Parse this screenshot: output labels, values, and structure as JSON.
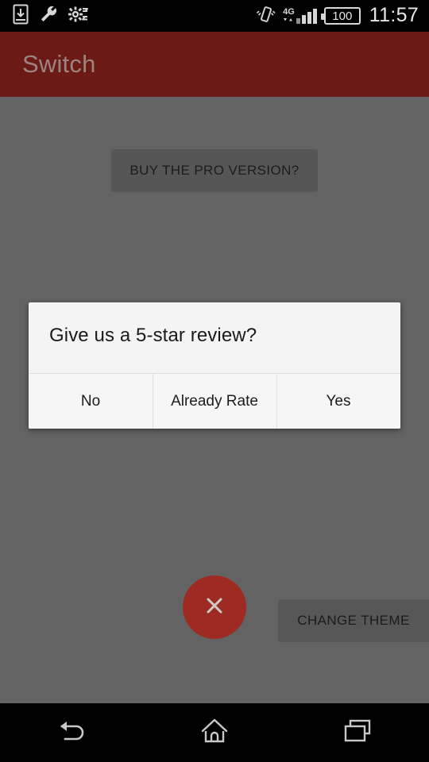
{
  "status_bar": {
    "icons_left": [
      {
        "name": "download-to-device-icon",
        "label": "download"
      },
      {
        "name": "wrench-icon",
        "label": "wrench"
      },
      {
        "name": "gear-sync-icon",
        "label": "settings-sync"
      }
    ],
    "icons_right": [
      {
        "name": "vibrate-icon",
        "label": "vibrate"
      },
      {
        "name": "signal-bars-icon",
        "label": "signal"
      }
    ],
    "network_label": "4G",
    "battery_level": "100",
    "clock": "11:57"
  },
  "action_bar": {
    "title": "Switch",
    "background_color": "#6b1a15",
    "title_color": "#9c8480"
  },
  "main": {
    "buy_pro_label": "BUY THE PRO VERSION?",
    "change_theme_label": "CHANGE THEME",
    "fab": {
      "icon": "close-x-icon",
      "color": "#9e2b23"
    },
    "scrim_color": "#636363"
  },
  "dialog": {
    "title": "Give us a 5-star review?",
    "background_color": "#f4f4f4",
    "buttons": [
      {
        "label": "No",
        "name": "dialog-button-no"
      },
      {
        "label": "Already Rate",
        "name": "dialog-button-already-rate"
      },
      {
        "label": "Yes",
        "name": "dialog-button-yes"
      }
    ]
  },
  "nav_bar": {
    "buttons": [
      {
        "name": "nav-back-button",
        "icon": "back-arrow-icon"
      },
      {
        "name": "nav-home-button",
        "icon": "home-icon"
      },
      {
        "name": "nav-recents-button",
        "icon": "recents-icon"
      }
    ]
  }
}
